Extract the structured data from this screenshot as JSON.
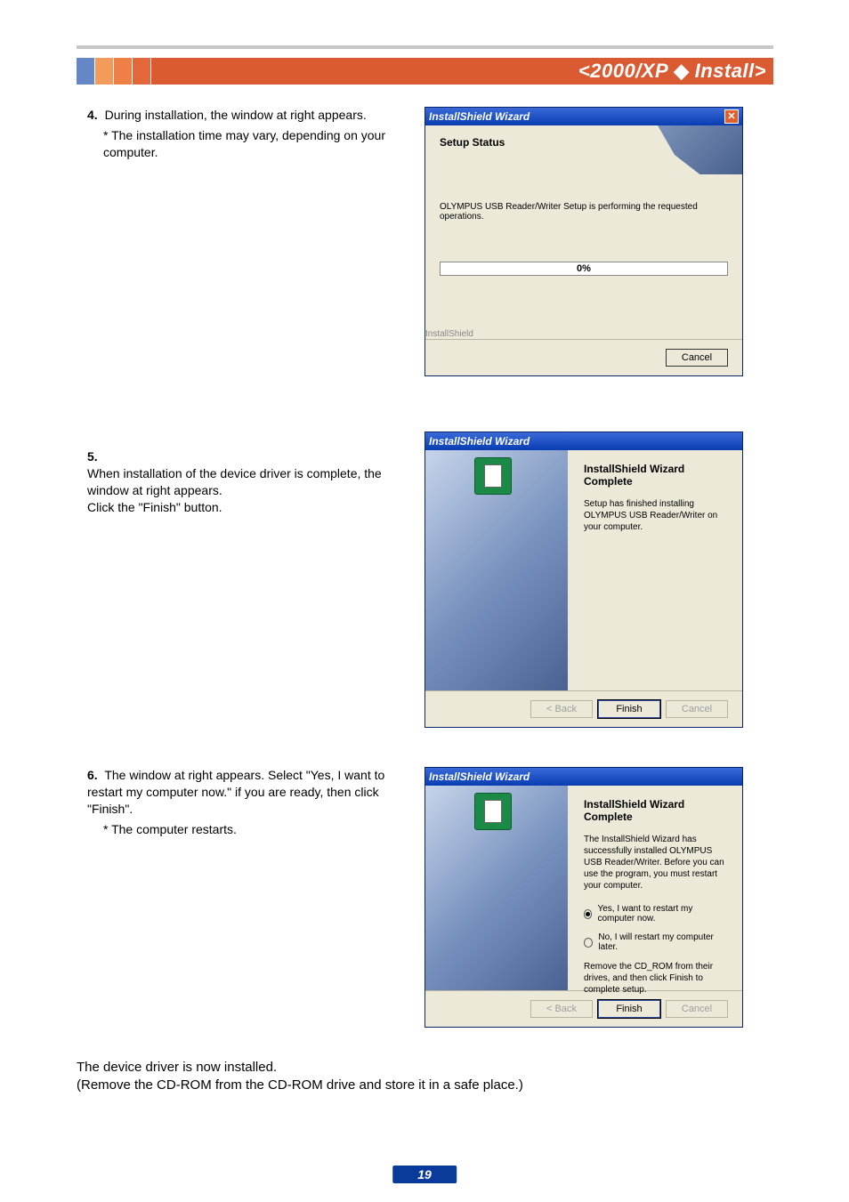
{
  "header": {
    "prefix": "<2000/XP",
    "suffix": "Install>",
    "separator": "◆"
  },
  "steps": {
    "s4": {
      "num": "4.",
      "text": "During installation, the window at right appears.",
      "note": "* The installation time may vary, depending on your computer."
    },
    "s5": {
      "num": "5.",
      "text": "When installation of the device driver is complete, the window at right appears.\nClick the \"Finish\" button."
    },
    "s6": {
      "num": "6.",
      "text": "The window at right appears. Select \"Yes, I want to restart my computer now.\" if you are ready, then click \"Finish\".",
      "note": "* The computer restarts."
    }
  },
  "conclusion": {
    "line1": "The device driver is now installed.",
    "line2": "(Remove the CD-ROM from the CD-ROM drive and store it in a safe place.)"
  },
  "win1": {
    "title": "InstallShield Wizard",
    "heading": "Setup Status",
    "msg": "OLYMPUS USB Reader/Writer Setup is performing the requested operations.",
    "progress": "0%",
    "tag": "InstallShield",
    "cancel": "Cancel"
  },
  "win2": {
    "title": "InstallShield Wizard",
    "heading": "InstallShield Wizard Complete",
    "msg": "Setup has finished installing OLYMPUS USB Reader/Writer on your computer.",
    "back": "< Back",
    "finish": "Finish",
    "cancel": "Cancel"
  },
  "win3": {
    "title": "InstallShield Wizard",
    "heading": "InstallShield Wizard Complete",
    "msg": "The InstallShield Wizard has successfully installed OLYMPUS USB Reader/Writer.  Before you can use the program, you must restart your computer.",
    "radio_yes": "Yes, I want to restart my computer now.",
    "radio_no": "No, I will restart my computer later.",
    "note": "Remove the CD_ROM from their drives, and then click Finish to complete setup.",
    "back": "< Back",
    "finish": "Finish",
    "cancel": "Cancel"
  },
  "page_number": "19"
}
